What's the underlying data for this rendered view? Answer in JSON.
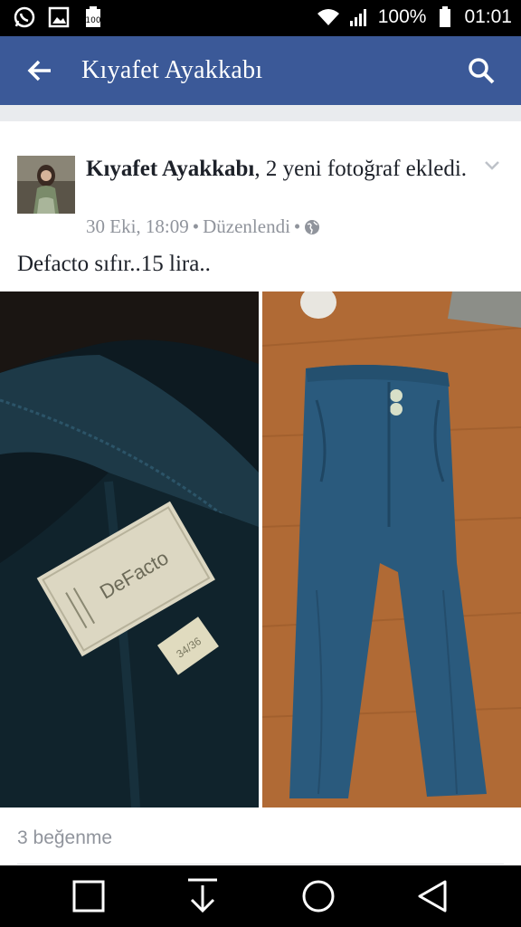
{
  "status_bar": {
    "icons": [
      "whatsapp-icon",
      "gallery-icon",
      "battery-100-notification-icon",
      "wifi-icon",
      "signal-icon",
      "battery-icon"
    ],
    "battery": "100%",
    "time": "01:01"
  },
  "app_bar": {
    "title": "Kıyafet Ayakkabı",
    "icons": [
      "back-arrow-icon",
      "search-icon"
    ]
  },
  "post": {
    "author": "Kıyafet Ayakkabı",
    "action": ", 2 yeni fotoğraf ekledi.",
    "date": "30 Eki, 18:09",
    "edited": "Düzenlendi",
    "separator": "•",
    "privacy_icon": "globe-icon",
    "text": "Defacto sıfır..15 lira..",
    "photos": [
      {
        "name": "clothing-label-photo",
        "label_text": "DeFacto",
        "size_text": "34/36"
      },
      {
        "name": "blue-trousers-photo"
      }
    ],
    "likes": "3 beğenme"
  },
  "colors": {
    "brand": "#3b5998",
    "feed_bg": "#e9ebee",
    "meta_text": "#90949c"
  },
  "nav_bar": {
    "icons": [
      "recent-apps-icon",
      "download-icon",
      "home-icon",
      "back-triangle-icon"
    ]
  }
}
